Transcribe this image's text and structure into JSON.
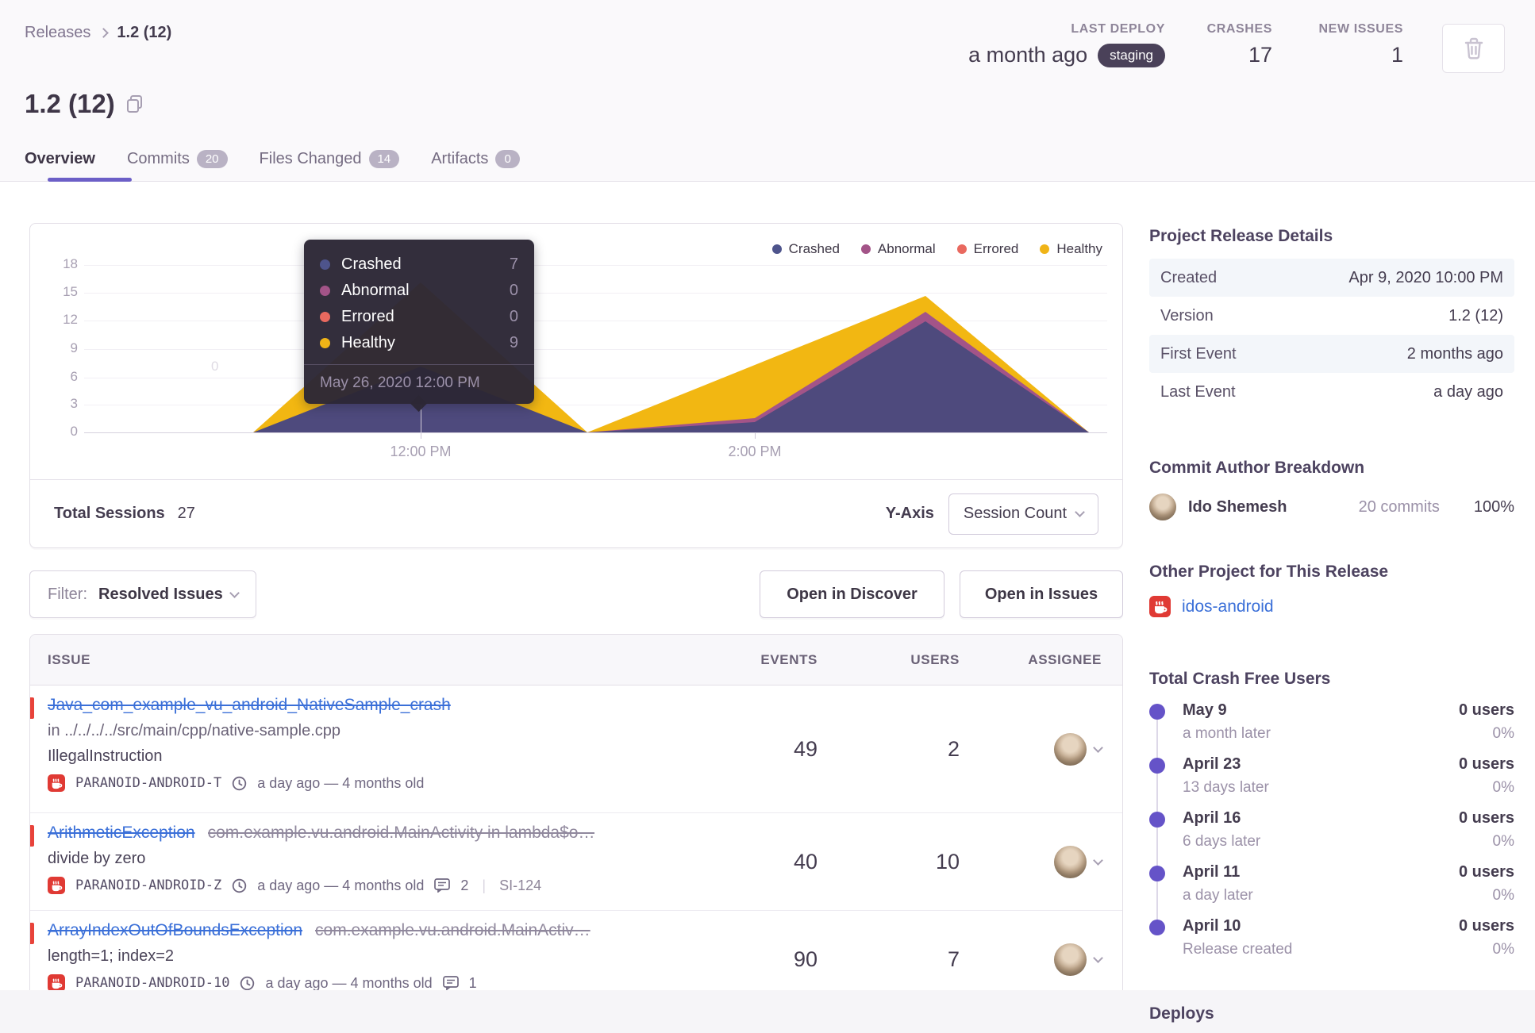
{
  "breadcrumb": {
    "root": "Releases",
    "current": "1.2 (12)"
  },
  "header": {
    "title": "1.2 (12)",
    "stats": [
      {
        "label": "LAST DEPLOY",
        "value": "a month ago",
        "badge": "staging"
      },
      {
        "label": "CRASHES",
        "value": "17"
      },
      {
        "label": "NEW ISSUES",
        "value": "1"
      }
    ]
  },
  "tabs": [
    {
      "label": "Overview"
    },
    {
      "label": "Commits",
      "count": "20"
    },
    {
      "label": "Files Changed",
      "count": "14"
    },
    {
      "label": "Artifacts",
      "count": "0"
    }
  ],
  "chart_data": {
    "type": "area",
    "title": "Release sessions over time",
    "legend": [
      "Crashed",
      "Abnormal",
      "Errored",
      "Healthy"
    ],
    "legend_position": "top-right",
    "colors": {
      "crashed": "#4e548c",
      "abnormal": "#a35488",
      "errored": "#e9695f",
      "healthy": "#f0b417"
    },
    "y_ticks": [
      "18",
      "15",
      "12",
      "9",
      "6",
      "3",
      "0"
    ],
    "ylim": [
      0,
      18
    ],
    "x_ticks": [
      "12:00 PM",
      "2:00 PM"
    ],
    "ghost_label": "0",
    "grid": true,
    "series": [
      {
        "name": "Crashed",
        "values": [
          0,
          7,
          0,
          1,
          12,
          0
        ]
      },
      {
        "name": "Abnormal",
        "values": [
          0,
          0,
          0,
          0,
          0.6,
          0
        ]
      },
      {
        "name": "Errored",
        "values": [
          0,
          0,
          0,
          0,
          0,
          0
        ]
      },
      {
        "name": "Healthy",
        "values": [
          0,
          9,
          0,
          6,
          2,
          0
        ]
      }
    ],
    "tooltip": {
      "rows": [
        {
          "label": "Crashed",
          "value": "7"
        },
        {
          "label": "Abnormal",
          "value": "0"
        },
        {
          "label": "Errored",
          "value": "0"
        },
        {
          "label": "Healthy",
          "value": "9"
        }
      ],
      "date": "May 26, 2020 12:00 PM"
    }
  },
  "sessions": {
    "total_label": "Total Sessions",
    "total_value": "27",
    "yaxis_label": "Y-Axis",
    "yaxis_value": "Session Count"
  },
  "toolbar": {
    "filter_prefix": "Filter:",
    "filter_value": "Resolved Issues",
    "discover_label": "Open in Discover",
    "issues_label": "Open in Issues"
  },
  "table": {
    "headers": {
      "issue": "ISSUE",
      "events": "EVENTS",
      "users": "USERS",
      "assignee": "ASSIGNEE"
    },
    "rows": [
      {
        "title": "Java_com_example_vu_android_NativeSample_crash",
        "subtitle": "",
        "path": "in ../../../../src/main/cpp/native-sample.cpp",
        "message": "IllegalInstruction",
        "project": "PARANOID-ANDROID-T",
        "age": "a day ago — 4 months old",
        "comments": "",
        "ticket": "",
        "events": "49",
        "users": "2"
      },
      {
        "title": "ArithmeticException",
        "subtitle": "com.example.vu.android.MainActivity in lambda$o…",
        "message": "divide by zero",
        "project": "PARANOID-ANDROID-Z",
        "age": "a day ago — 4 months old",
        "comments": "2",
        "ticket": "SI-124",
        "events": "40",
        "users": "10"
      },
      {
        "title": "ArrayIndexOutOfBoundsException",
        "subtitle": "com.example.vu.android.MainActiv…",
        "message": "length=1; index=2",
        "project": "PARANOID-ANDROID-10",
        "age": "a day ago — 4 months old",
        "comments": "1",
        "ticket": "",
        "events": "90",
        "users": "7"
      }
    ]
  },
  "sidebar": {
    "details": {
      "title": "Project Release Details",
      "rows": [
        {
          "label": "Created",
          "value": "Apr 9, 2020 10:00 PM"
        },
        {
          "label": "Version",
          "value": "1.2 (12)"
        },
        {
          "label": "First Event",
          "value": "2 months ago"
        },
        {
          "label": "Last Event",
          "value": "a day ago"
        }
      ]
    },
    "authors": {
      "title": "Commit Author Breakdown",
      "name": "Ido Shemesh",
      "commits": "20 commits",
      "percent": "100%"
    },
    "other_project": {
      "title": "Other Project for This Release",
      "project": "idos-android"
    },
    "crashfree": {
      "title": "Total Crash Free Users",
      "entries": [
        {
          "title": "May 9",
          "sub": "a month later",
          "users": "0 users",
          "pct": "0%"
        },
        {
          "title": "April 23",
          "sub": "13 days later",
          "users": "0 users",
          "pct": "0%"
        },
        {
          "title": "April 16",
          "sub": "6 days later",
          "users": "0 users",
          "pct": "0%"
        },
        {
          "title": "April 11",
          "sub": "a day later",
          "users": "0 users",
          "pct": "0%"
        },
        {
          "title": "April 10",
          "sub": "Release created",
          "users": "0 users",
          "pct": "0%"
        }
      ]
    },
    "deploys_title": "Deploys"
  }
}
